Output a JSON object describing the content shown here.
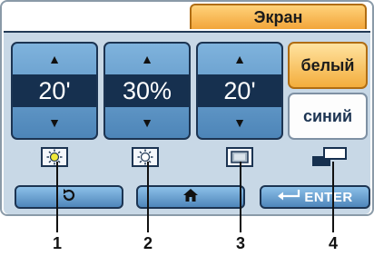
{
  "screen": {
    "tab_label": "Экран"
  },
  "steppers": [
    {
      "value": "20'",
      "up_icon": "triangle-up-icon",
      "down_icon": "triangle-down-icon"
    },
    {
      "value": "30%",
      "up_icon": "triangle-up-icon",
      "down_icon": "triangle-down-icon"
    },
    {
      "value": "20'",
      "up_icon": "triangle-up-icon",
      "down_icon": "triangle-down-icon"
    }
  ],
  "color_options": {
    "white_label": "белый",
    "blue_label": "синий",
    "selected": "белый"
  },
  "indicator_icons": [
    "sun-bright-icon",
    "sun-dim-icon",
    "screen-icon",
    "backlight-color-icon"
  ],
  "bottom_bar": {
    "back_icon": "rotate-back-icon",
    "home_icon": "home-icon",
    "enter_label": "ENTER",
    "enter_icon": "enter-arrow-icon"
  },
  "callouts": [
    "1",
    "2",
    "3",
    "4"
  ],
  "colors": {
    "accent": "#f2a53a",
    "panel_bg": "#c8d8e6",
    "value_bg": "#16304f",
    "sun_yellow": "#f0e83a"
  }
}
